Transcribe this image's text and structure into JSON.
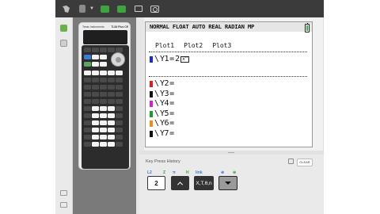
{
  "calculator": {
    "brand": "Texas Instruments",
    "model": "TI-84 Plus CE"
  },
  "screen": {
    "status_bar": "NORMAL FLOAT AUTO REAL RADIAN MP",
    "plots": [
      "Plot1",
      "Plot2",
      "Plot3"
    ],
    "functions": [
      {
        "label": "Y1",
        "expr": "2",
        "color": "#1a2bd8",
        "active": true
      },
      {
        "label": "Y2",
        "expr": "",
        "color": "#e01b1b"
      },
      {
        "label": "Y3",
        "expr": "",
        "color": "#111111"
      },
      {
        "label": "Y4",
        "expr": "",
        "color": "#d81bd8"
      },
      {
        "label": "Y5",
        "expr": "",
        "color": "#1a9a2a"
      },
      {
        "label": "Y6",
        "expr": "",
        "color": "#f08a1a"
      },
      {
        "label": "Y7",
        "expr": "",
        "color": "#111111"
      }
    ],
    "cursor_superscript": "x^"
  },
  "history": {
    "title": "Key Press History",
    "clear_label": "CLEAR",
    "second_labels": [
      {
        "text": "L2",
        "color": "#3b7dd8"
      },
      {
        "text": "Z",
        "color": "#3fa33f"
      },
      {
        "text": "π",
        "color": "#3b7dd8"
      },
      {
        "text": "H",
        "color": "#3fa33f"
      },
      {
        "text": "link",
        "color": "#3b7dd8"
      },
      {
        "text": "⊕",
        "color": "#3b7dd8"
      },
      {
        "text": "⊕",
        "color": "#3fa33f"
      }
    ],
    "keys": [
      {
        "label": "2"
      },
      {
        "label": ""
      },
      {
        "label": "X,T,θ,n"
      },
      {
        "label": ""
      }
    ]
  },
  "icons": {
    "toolbar": [
      "ti-logo-icon",
      "calculator-menu-icon",
      "keypad-icon",
      "display-icon",
      "document-icon",
      "camera-icon"
    ],
    "rail": [
      "calculator-icon",
      "document-icon"
    ]
  }
}
